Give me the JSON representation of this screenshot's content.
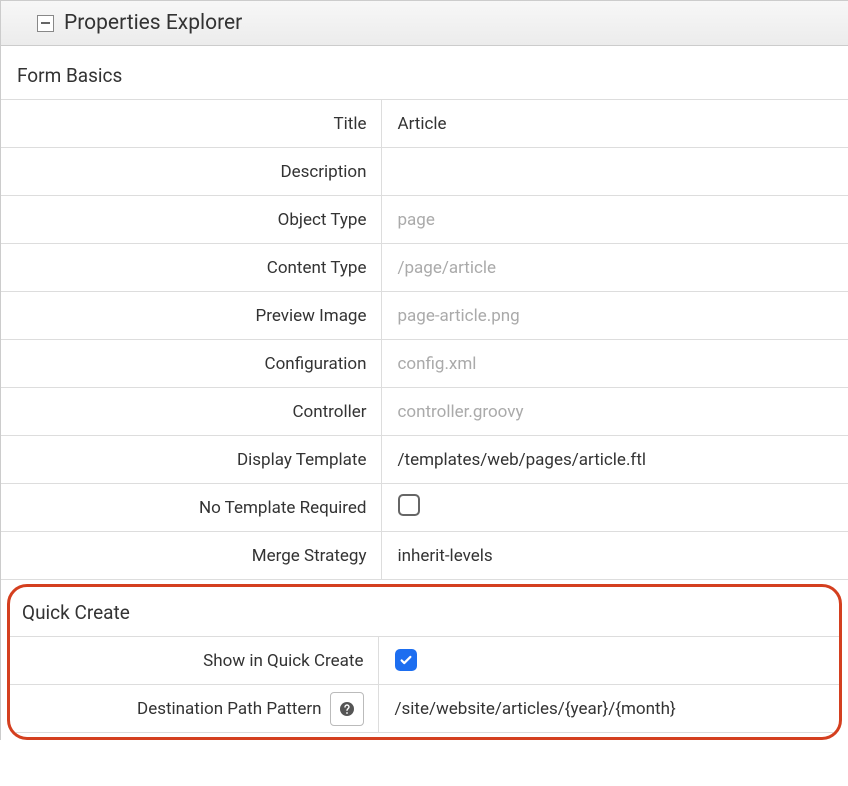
{
  "header": {
    "title": "Properties Explorer"
  },
  "form_basics": {
    "section_title": "Form Basics",
    "rows": {
      "title": {
        "label": "Title",
        "value": "Article"
      },
      "description": {
        "label": "Description",
        "value": ""
      },
      "object_type": {
        "label": "Object Type",
        "value": "page"
      },
      "content_type": {
        "label": "Content Type",
        "value": "/page/article"
      },
      "preview_image": {
        "label": "Preview Image",
        "value": "page-article.png"
      },
      "configuration": {
        "label": "Configuration",
        "value": "config.xml"
      },
      "controller": {
        "label": "Controller",
        "value": "controller.groovy"
      },
      "display_template": {
        "label": "Display Template",
        "value": "/templates/web/pages/article.ftl"
      },
      "no_template_required": {
        "label": "No Template Required",
        "checked": false
      },
      "merge_strategy": {
        "label": "Merge Strategy",
        "value": "inherit-levels"
      }
    }
  },
  "quick_create": {
    "section_title": "Quick Create",
    "rows": {
      "show_in_quick_create": {
        "label": "Show in Quick Create",
        "checked": true
      },
      "destination_path_pattern": {
        "label": "Destination Path Pattern",
        "value": "/site/website/articles/{year}/{month}"
      }
    }
  }
}
